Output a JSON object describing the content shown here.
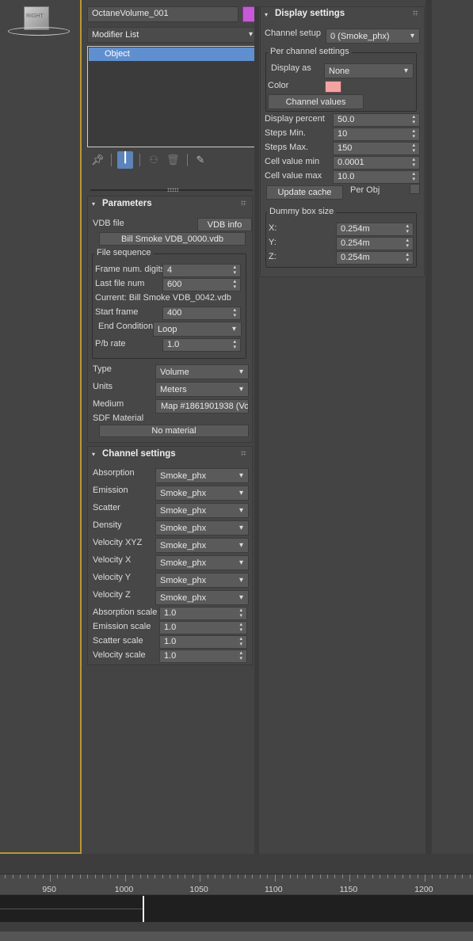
{
  "viewport": {
    "view_label": "RIGHT"
  },
  "object": {
    "name": "OctaneVolume_001",
    "color": "#c55ad8"
  },
  "modifier_list": {
    "label": "Modifier List"
  },
  "stack": {
    "items": [
      "Object"
    ]
  },
  "toolbar": {
    "icons": [
      "pin-icon",
      "show-end-result-icon",
      "make-unique-icon",
      "trash-icon",
      "configure-sets-icon"
    ]
  },
  "parameters": {
    "title": "Parameters",
    "vdb_file_label": "VDB file",
    "vdb_info_button": "VDB info",
    "vdb_file_button": "Bill Smoke VDB_0000.vdb",
    "file_sequence": {
      "group_label": "File sequence",
      "frame_num_digits_label": "Frame num. digits",
      "frame_num_digits": "4",
      "last_file_num_label": "Last file num",
      "last_file_num": "600",
      "current_text": "Current: Bill Smoke VDB_0042.vdb",
      "start_frame_label": "Start frame",
      "start_frame": "400",
      "end_condition_label": "End Condition",
      "end_condition": "Loop",
      "pb_rate_label": "P/b rate",
      "pb_rate": "1.0"
    },
    "type_label": "Type",
    "type_value": "Volume",
    "units_label": "Units",
    "units_value": "Meters",
    "medium_label": "Medium",
    "medium_value": "Map #1861901938 (Vo",
    "sdf_material_label": "SDF Material",
    "sdf_material_button": "No material"
  },
  "channel_settings": {
    "title": "Channel settings",
    "channels": [
      {
        "label": "Absorption",
        "value": "Smoke_phx"
      },
      {
        "label": "Emission",
        "value": "Smoke_phx"
      },
      {
        "label": "Scatter",
        "value": "Smoke_phx"
      },
      {
        "label": "Density",
        "value": "Smoke_phx"
      },
      {
        "label": "Velocity XYZ",
        "value": "Smoke_phx"
      },
      {
        "label": "Velocity X",
        "value": "Smoke_phx"
      },
      {
        "label": "Velocity Y",
        "value": "Smoke_phx"
      },
      {
        "label": "Velocity Z",
        "value": "Smoke_phx"
      }
    ],
    "scales": [
      {
        "label": "Absorption scale",
        "value": "1.0"
      },
      {
        "label": "Emission scale",
        "value": "1.0"
      },
      {
        "label": "Scatter scale",
        "value": "1.0"
      },
      {
        "label": "Velocity scale",
        "value": "1.0"
      }
    ]
  },
  "display_settings": {
    "title": "Display settings",
    "channel_setup_label": "Channel setup",
    "channel_setup_value": "0 (Smoke_phx)",
    "per_channel_group_label": "Per channel settings",
    "display_as_label": "Display as",
    "display_as_value": "None",
    "color_label": "Color",
    "color_value": "#f4a3a3",
    "channel_values_button": "Channel values",
    "display_percent_label": "Display percent",
    "display_percent": "50.0",
    "steps_min_label": "Steps Min.",
    "steps_min": "10",
    "steps_max_label": "Steps Max.",
    "steps_max": "150",
    "cell_value_min_label": "Cell value min",
    "cell_value_min": "0.0001",
    "cell_value_max_label": "Cell value max",
    "cell_value_max": "10.0",
    "update_cache_button": "Update cache",
    "per_obj_label": "Per Obj",
    "dummy_box_group_label": "Dummy box size",
    "x_label": "X:",
    "x_value": "0.254m",
    "y_label": "Y:",
    "y_value": "0.254m",
    "z_label": "Z:",
    "z_value": "0.254m"
  },
  "timeline": {
    "ticks": [
      "950",
      "1000",
      "1050",
      "1100",
      "1150",
      "1200"
    ],
    "current_frame_marker": "1010"
  }
}
